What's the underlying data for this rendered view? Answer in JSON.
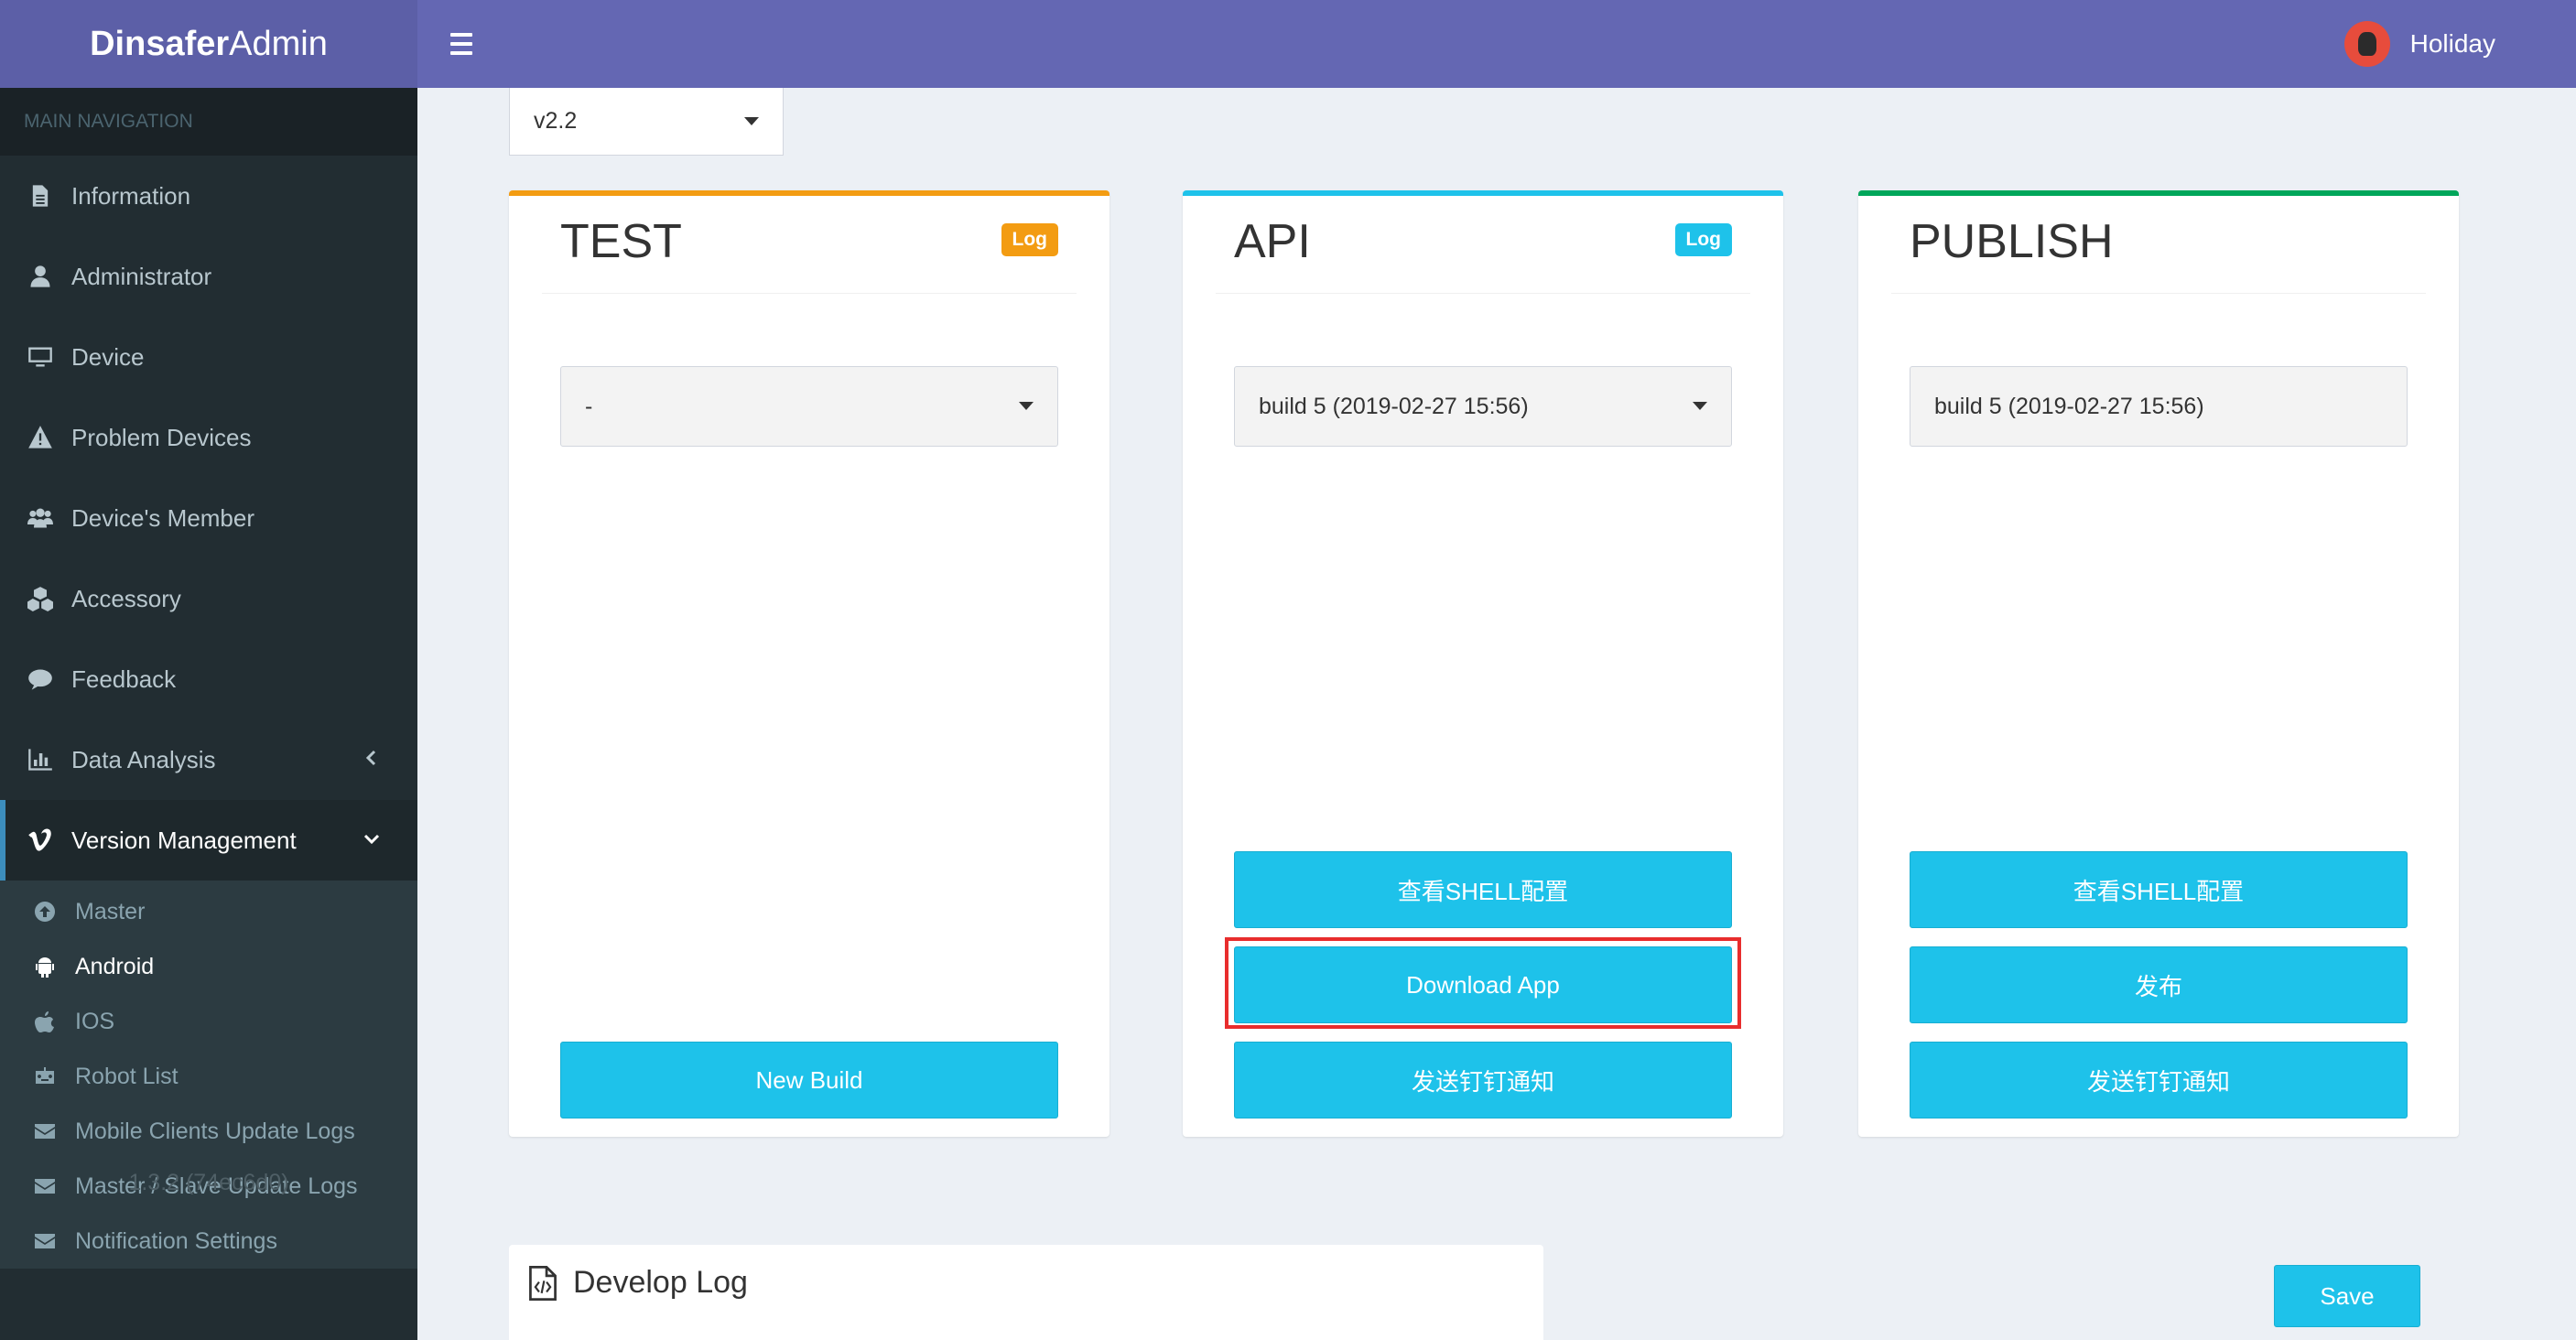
{
  "brand": {
    "bold": "Dinsafer",
    "light": "Admin"
  },
  "header": {
    "user_name": "Holiday"
  },
  "sidebar": {
    "section_label": "MAIN NAVIGATION",
    "items": [
      {
        "label": "Information"
      },
      {
        "label": "Administrator"
      },
      {
        "label": "Device"
      },
      {
        "label": "Problem Devices"
      },
      {
        "label": "Device's Member"
      },
      {
        "label": "Accessory"
      },
      {
        "label": "Feedback"
      },
      {
        "label": "Data Analysis"
      },
      {
        "label": "Version Management"
      }
    ],
    "subitems": [
      {
        "label": "Master"
      },
      {
        "label": "Android"
      },
      {
        "label": "IOS"
      },
      {
        "label": "Robot List"
      },
      {
        "label": "Mobile Clients Update Logs"
      },
      {
        "label": "Master / Slave Update Logs"
      },
      {
        "label": "Notification Settings"
      }
    ],
    "active_subitem": "Android",
    "version": "1.3.2 (74ec6d0)"
  },
  "main": {
    "version_select": "v2.2",
    "test": {
      "title": "TEST",
      "badge": "Log",
      "select_value": "-",
      "new_build_label": "New Build"
    },
    "api": {
      "title": "API",
      "badge": "Log",
      "select_value": "build 5 (2019-02-27 15:56)",
      "shell_label": "查看SHELL配置",
      "download_label": "Download App",
      "notify_label": "发送钉钉通知"
    },
    "publish": {
      "title": "PUBLISH",
      "field_value": "build 5 (2019-02-27 15:56)",
      "shell_label": "查看SHELL配置",
      "publish_label": "发布",
      "notify_label": "发送钉钉通知"
    },
    "develop_log": {
      "title": "Develop Log",
      "save_label": "Save"
    }
  },
  "colors": {
    "header": "#6467b3",
    "logo_bg": "#5c5fa7",
    "sidebar": "#222d32",
    "button": "#1ec2ea",
    "test_accent": "#f39c12",
    "api_accent": "#1ec2ea",
    "publish_accent": "#00a65a",
    "highlight": "#e82d2d"
  },
  "icons": {
    "information": "file-icon",
    "administrator": "user-icon",
    "device": "monitor-icon",
    "problem_devices": "warning-icon",
    "devices_member": "users-icon",
    "accessory": "cubes-icon",
    "feedback": "comment-icon",
    "data_analysis": "bar-chart-icon",
    "version_management": "vimeo-icon"
  }
}
